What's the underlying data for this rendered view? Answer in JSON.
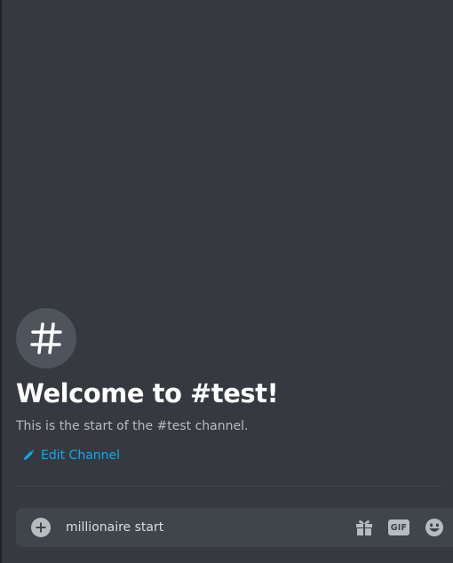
{
  "channel": {
    "hash_symbol": "#",
    "welcome_title": "Welcome to #test!",
    "welcome_subtitle": "This is the start of the #test channel.",
    "edit_label": "Edit Channel"
  },
  "composer": {
    "message_value": "millionaire start",
    "gif_label": "GIF"
  },
  "icons": {
    "hash": "hash-icon",
    "edit": "pencil-icon",
    "attach": "plus-circle-icon",
    "gift": "gift-icon",
    "gif": "gif-icon",
    "emoji": "smiley-emoji-icon"
  },
  "colors": {
    "background": "#36393f",
    "composer_bg": "#40444b",
    "hash_circle": "#4f545c",
    "title": "#ffffff",
    "subtitle": "#b9bbbe",
    "link": "#00aff4",
    "icon": "#b9bbbe"
  }
}
